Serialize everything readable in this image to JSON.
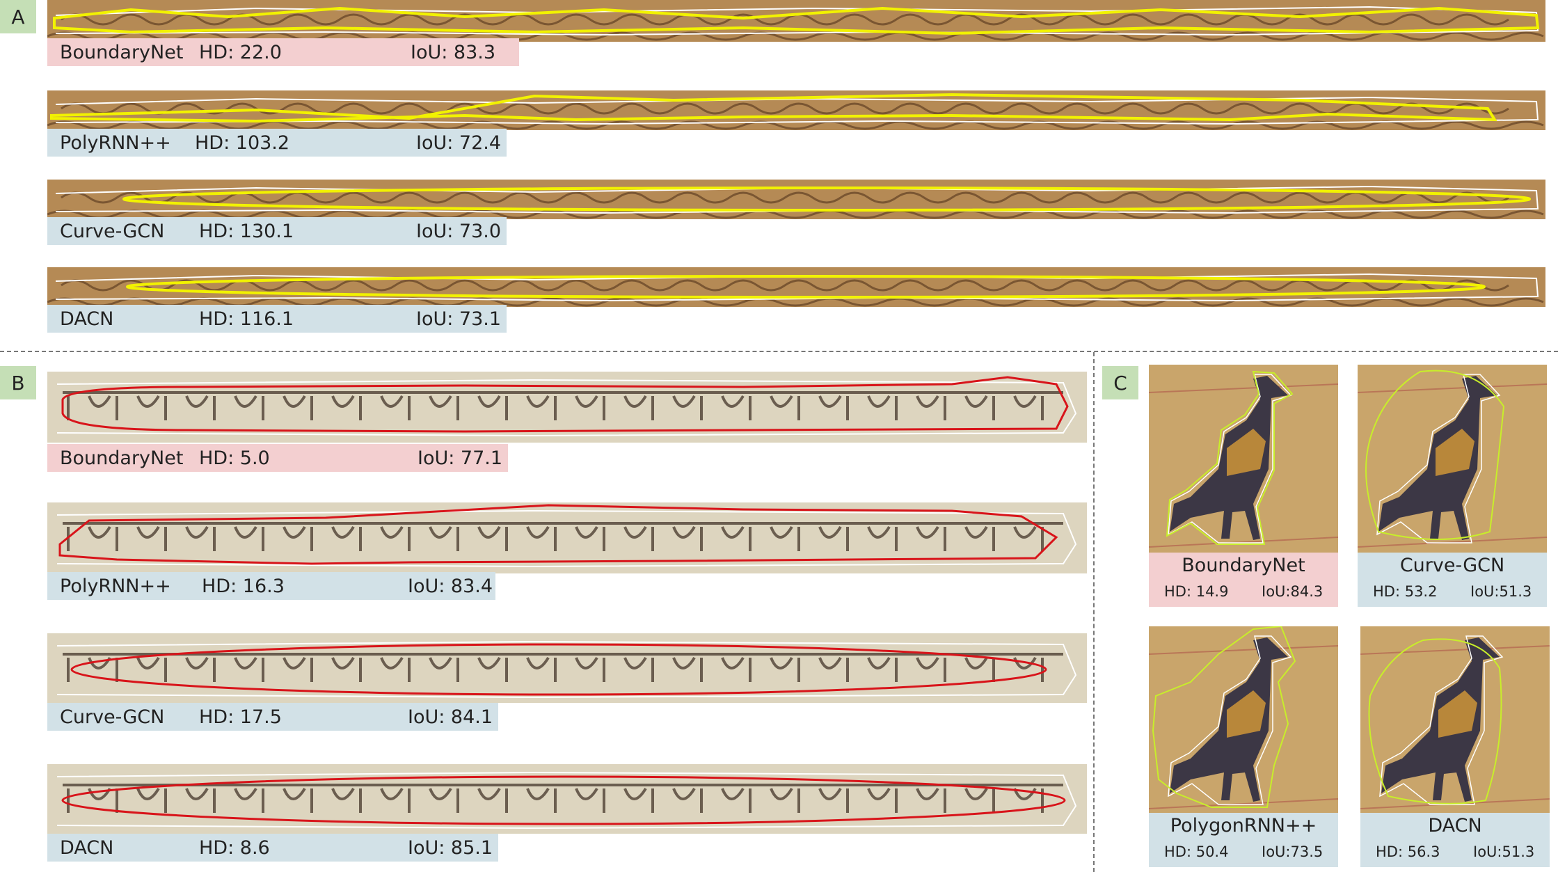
{
  "panels": {
    "a": {
      "tag": "A",
      "rows": [
        {
          "method": "BoundaryNet",
          "hd": "HD: 22.0",
          "iou": "IoU: 83.3",
          "highlight": true
        },
        {
          "method": "PolyRNN++",
          "hd": "HD: 103.2",
          "iou": "IoU: 72.4",
          "highlight": false
        },
        {
          "method": "Curve-GCN",
          "hd": "HD: 130.1",
          "iou": "IoU: 73.0",
          "highlight": false
        },
        {
          "method": "DACN",
          "hd": "HD: 116.1",
          "iou": "IoU: 73.1",
          "highlight": false
        }
      ]
    },
    "b": {
      "tag": "B",
      "rows": [
        {
          "method": "BoundaryNet",
          "hd": "HD: 5.0",
          "iou": "IoU: 77.1",
          "highlight": true
        },
        {
          "method": "PolyRNN++",
          "hd": "HD: 16.3",
          "iou": "IoU: 83.4",
          "highlight": false
        },
        {
          "method": "Curve-GCN",
          "hd": "HD: 17.5",
          "iou": "IoU: 84.1",
          "highlight": false
        },
        {
          "method": "DACN",
          "hd": "HD: 8.6",
          "iou": "IoU: 85.1",
          "highlight": false
        }
      ]
    },
    "c": {
      "tag": "C",
      "cards": [
        {
          "method": "BoundaryNet",
          "hd": "HD: 14.9",
          "iou": "IoU:84.3",
          "highlight": true
        },
        {
          "method": "Curve-GCN",
          "hd": "HD: 53.2",
          "iou": "IoU:51.3",
          "highlight": false
        },
        {
          "method": "PolygonRNN++",
          "hd": "HD: 50.4",
          "iou": "IoU:73.5",
          "highlight": false
        },
        {
          "method": "DACN",
          "hd": "HD: 56.3",
          "iou": "IoU:51.3",
          "highlight": false
        }
      ]
    }
  },
  "colors": {
    "tag_green": "#c5dfb6",
    "highlight_pink": "#f3cfd0",
    "label_blue": "#d2e1e7",
    "palm_leaf": "#b58a55",
    "manuscript_paper": "#ddd5bf",
    "bird_background": "#c9a56b",
    "contour_yellow": "#f2f200",
    "contour_red": "#d8141a",
    "contour_lime": "#c8ee2a",
    "ground_truth_white": "#ffffff"
  }
}
